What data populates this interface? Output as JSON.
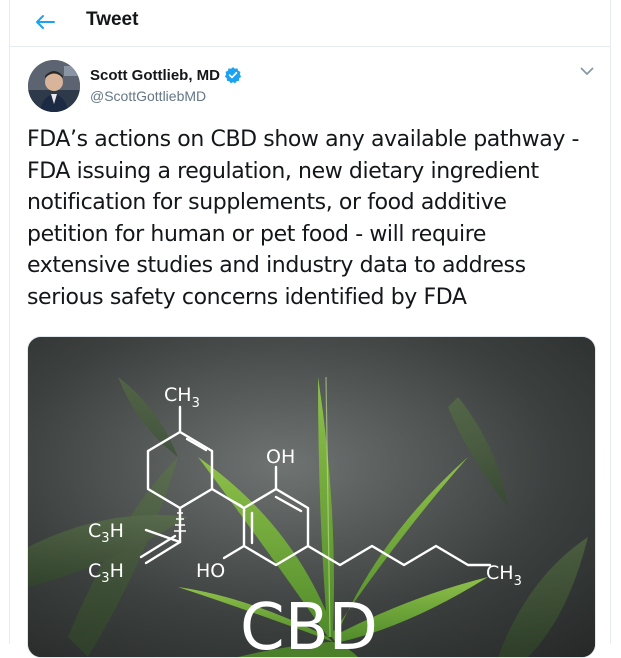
{
  "header": {
    "back_icon": "arrow-left-icon",
    "title": "Tweet"
  },
  "tweet": {
    "author": {
      "display_name": "Scott Gottlieb, MD",
      "handle": "@ScottGottliebMD",
      "verified": true
    },
    "text": "FDA’s actions on CBD show any available pathway -\nFDA issuing a regulation, new dietary ingredient\nnotification for supplements, or food additive\npetition for human or pet food - will require\nextensive studies and industry data to address\nserious safety concerns identified by FDA",
    "media": {
      "labels": {
        "ch3_top": "CH",
        "ch3_top_sub": "3",
        "oh": "OH",
        "c3h_1": "C",
        "c3h_1_sub": "3",
        "c3h_1_tail": "H",
        "c3h_2": "C",
        "c3h_2_sub": "3",
        "c3h_2_tail": "H",
        "ho": "HO",
        "ch3_right": "CH",
        "ch3_right_sub": "3",
        "cbd": "CBD"
      }
    }
  },
  "colors": {
    "accent": "#1da1f2",
    "text": "#14171a",
    "secondary": "#657786",
    "border": "#e6ecf0"
  }
}
